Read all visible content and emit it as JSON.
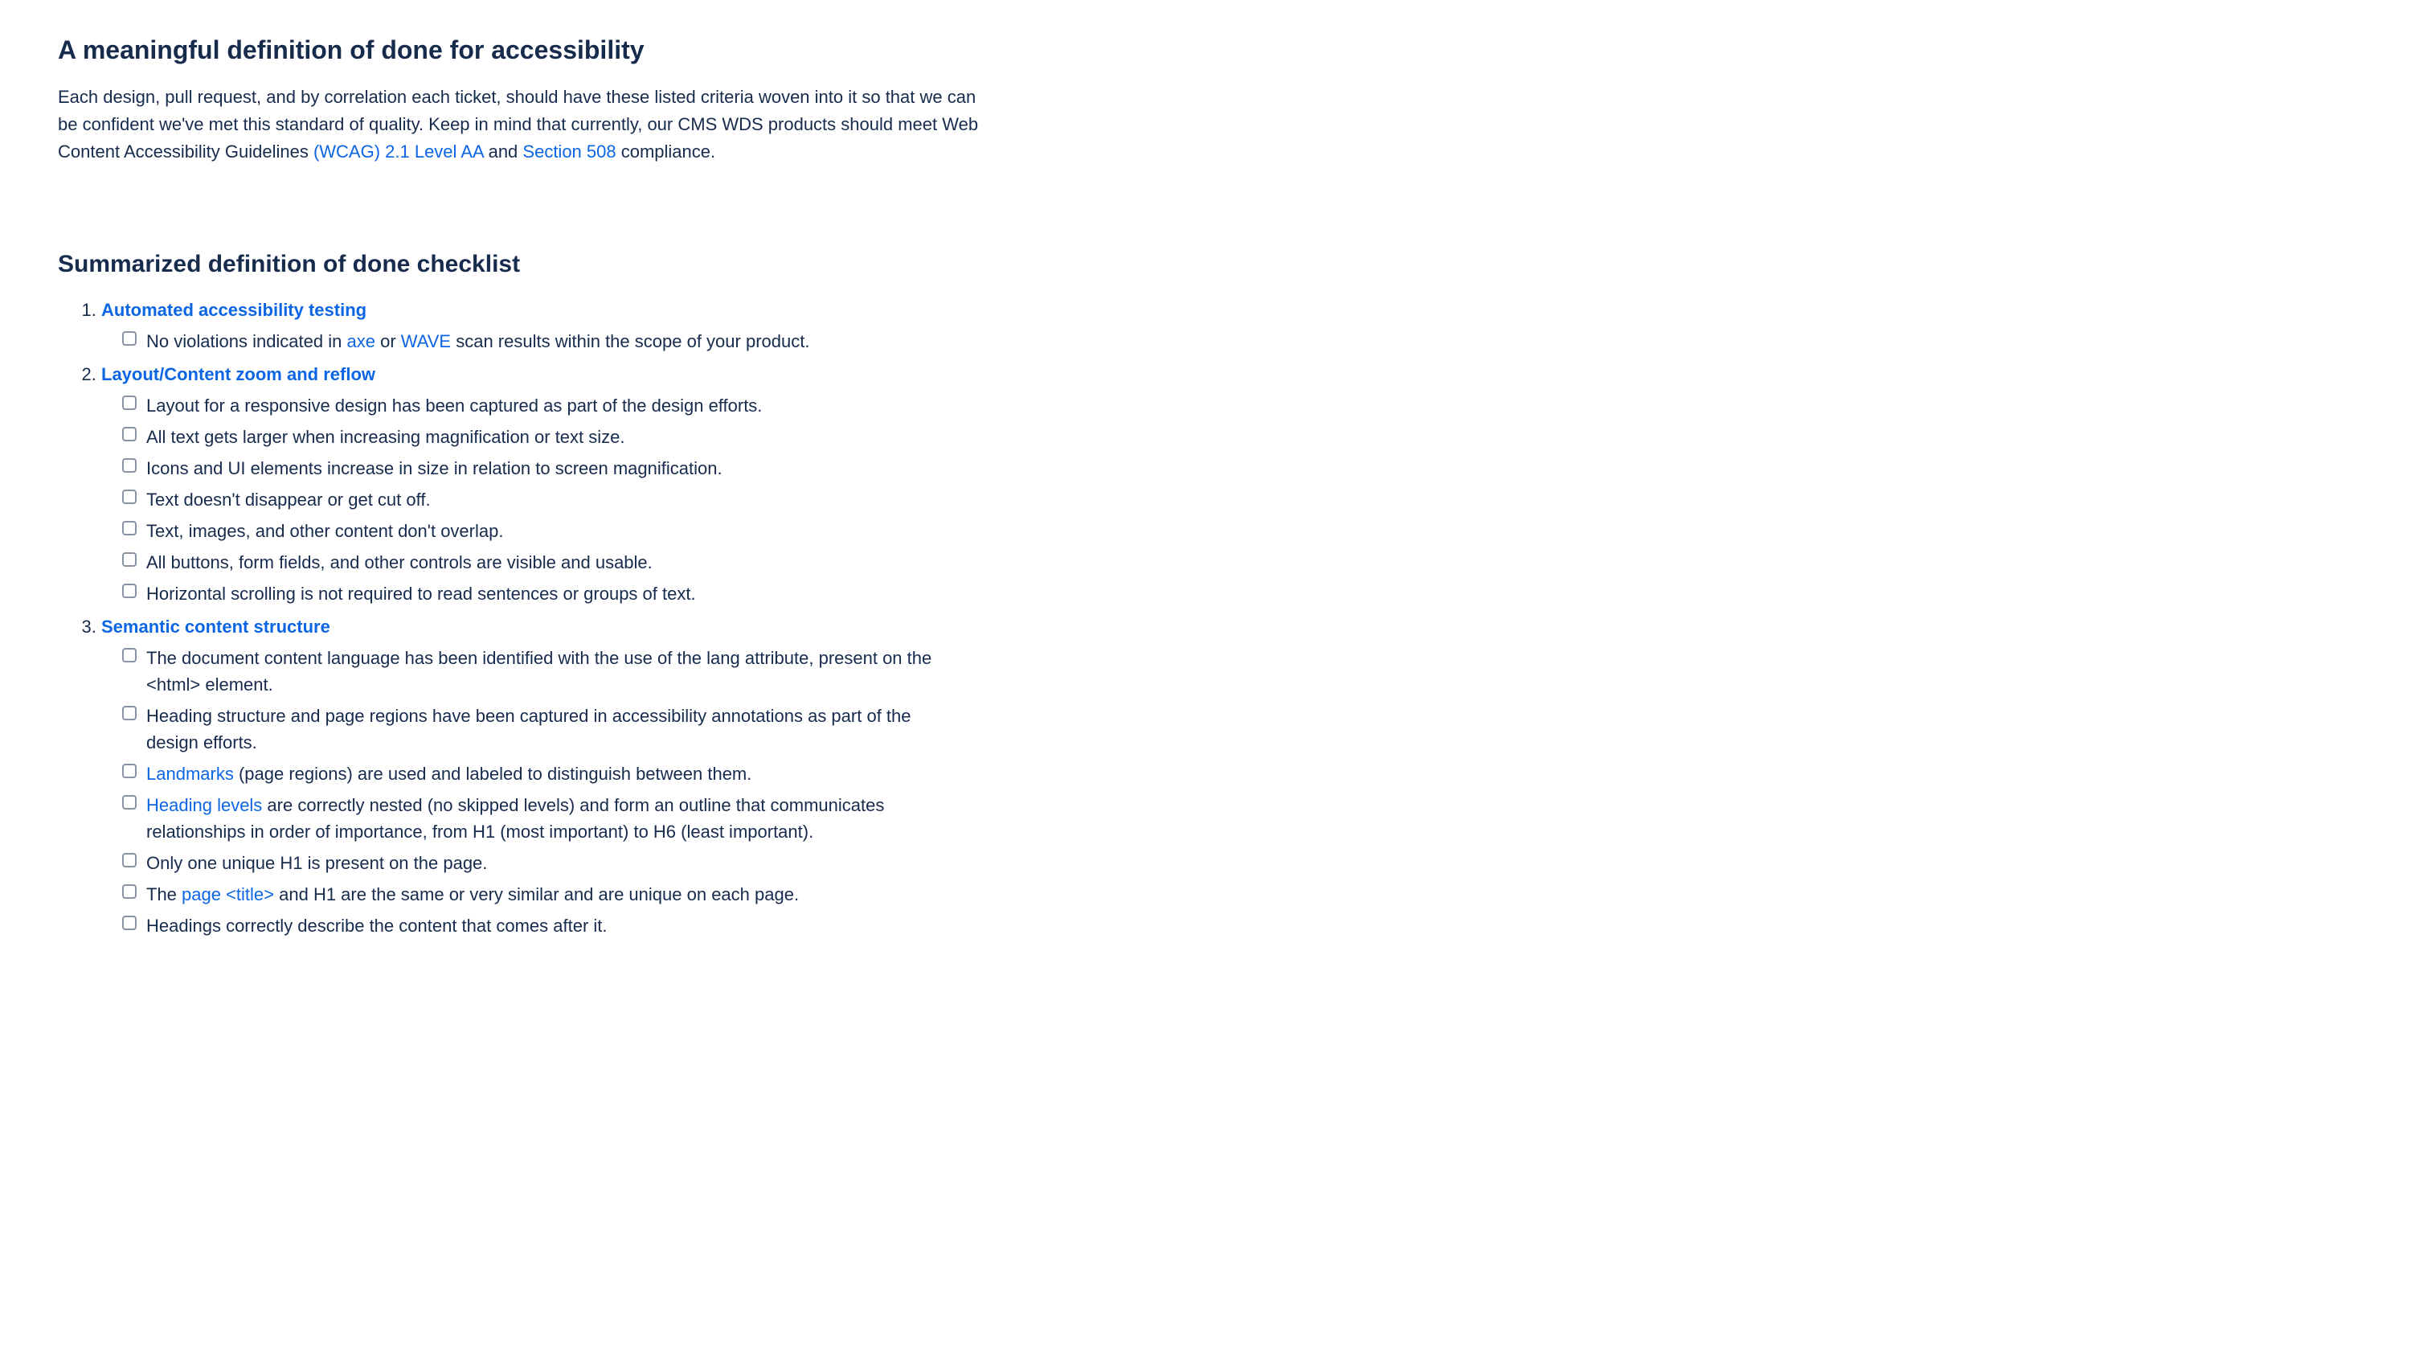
{
  "header": {
    "title": "A meaningful definition of done for accessibility",
    "intro_pre": "Each design, pull request, and by correlation each ticket, should have these listed criteria woven into it so that we can be confident we've met this standard of quality. Keep in mind that currently, our CMS WDS products should meet Web Content Accessibility Guidelines ",
    "wcag_link": "(WCAG) 2.1 Level AA",
    "intro_mid": " and ",
    "s508_link": "Section 508",
    "intro_post": " compliance."
  },
  "checklist_heading": "Summarized definition of done checklist",
  "sections": [
    {
      "title": "Automated accessibility testing",
      "items": [
        {
          "pre": "No violations indicated in ",
          "link1": "axe",
          "mid": " or ",
          "link2": "WAVE",
          "post": " scan results within the scope of your product."
        }
      ]
    },
    {
      "title": "Layout/Content zoom and reflow",
      "items": [
        {
          "text": "Layout for a responsive design has been captured as part of the design efforts."
        },
        {
          "text": "All text gets larger when increasing magnification or text size."
        },
        {
          "text": "Icons and UI elements increase in size in relation to screen magnification."
        },
        {
          "text": "Text doesn't disappear or get cut off."
        },
        {
          "text": "Text, images, and other content don't overlap."
        },
        {
          "text": "All buttons, form fields, and other controls are visible and usable."
        },
        {
          "text": "Horizontal scrolling is not required to read sentences or groups of text."
        }
      ]
    },
    {
      "title": "Semantic content structure",
      "items": [
        {
          "text": "The document content language has been identified with the use of the lang attribute, present on the <html> element."
        },
        {
          "text": "Heading structure and page regions have been captured in accessibility annotations as part of the design efforts."
        },
        {
          "link1": "Landmarks",
          "post": " (page regions) are used and labeled to distinguish between them."
        },
        {
          "link1": "Heading levels",
          "post": " are correctly nested (no skipped levels) and form an outline that communicates relationships in order of importance, from H1 (most important) to H6 (least important)."
        },
        {
          "text": "Only one unique H1 is present on the page."
        },
        {
          "pre": "The ",
          "link1": "page <title>",
          "post": " and H1 are the same or very similar and are unique on each page."
        },
        {
          "text": "Headings correctly describe the content that comes after it."
        }
      ]
    }
  ]
}
